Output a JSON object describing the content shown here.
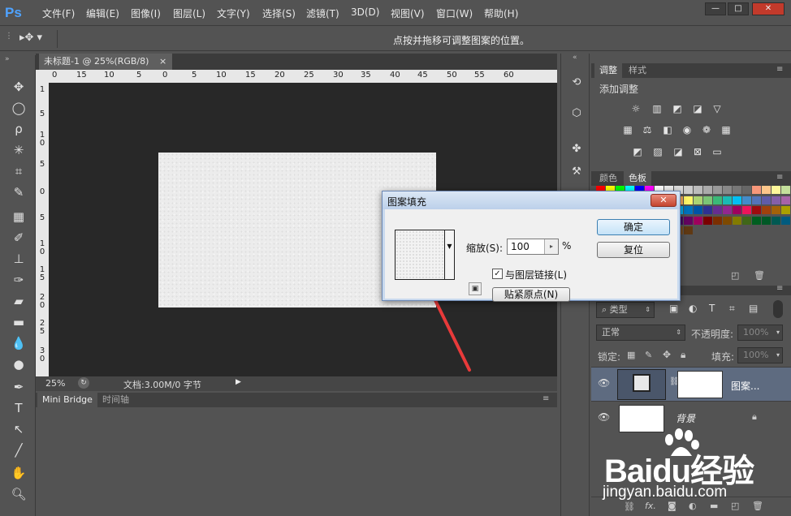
{
  "app": {
    "logo": "Ps"
  },
  "menu": [
    "文件(F)",
    "编辑(E)",
    "图像(I)",
    "图层(L)",
    "文字(Y)",
    "选择(S)",
    "滤镜(T)",
    "3D(D)",
    "视图(V)",
    "窗口(W)",
    "帮助(H)"
  ],
  "window_controls": {
    "minimize": "—",
    "maximize": "□",
    "close": "✕"
  },
  "options_bar": {
    "hint": "点按并拖移可调整图案的位置。"
  },
  "document_tab": {
    "title": "未标题-1 @ 25%(RGB/8)",
    "close": "×"
  },
  "ruler_top": [
    "0",
    "15",
    "10",
    "5",
    "0",
    "5",
    "10",
    "15",
    "20",
    "25",
    "30",
    "35",
    "40",
    "45",
    "50",
    "55",
    "60"
  ],
  "ruler_left": [
    "1",
    "5",
    "1",
    "0",
    "5",
    "0",
    "5",
    "1",
    "0",
    "1",
    "5",
    "2",
    "0",
    "2",
    "5",
    "3",
    "0"
  ],
  "status_bar": {
    "zoom": "25%",
    "doc_info": "文档:3.00M/0 字节",
    "arrow": "▶"
  },
  "bottom_panel": {
    "tabs": [
      "Mini Bridge",
      "时间轴"
    ]
  },
  "adjustments": {
    "tabs": [
      "调整",
      "样式"
    ],
    "heading": "添加调整"
  },
  "color_panel": {
    "tabs": [
      "颜色",
      "色板"
    ]
  },
  "layers_panel": {
    "filter_kind": "类型",
    "blend_mode": "正常",
    "opacity_label": "不透明度:",
    "opacity_value": "100%",
    "lock_label": "锁定:",
    "fill_label": "填充:",
    "fill_value": "100%",
    "layers": [
      {
        "name": "图案...",
        "visible": true
      },
      {
        "name": "背景",
        "visible": true
      }
    ]
  },
  "dialog": {
    "title": "图案填充",
    "close": "✕",
    "scale_label": "缩放(S):",
    "scale_value": "100",
    "percent": "%",
    "link_label": "与图层链接(L)",
    "link_checked": true,
    "snap_button": "贴紧原点(N)",
    "ok_button": "确定",
    "reset_button": "复位"
  },
  "watermark": {
    "logo": "Baidu经验",
    "url": "jingyan.baidu.com"
  },
  "colors": {
    "accent_arrow": "#e83a3a",
    "ps_blue": "#4fa3ff",
    "canvas_bg": "#282828"
  }
}
